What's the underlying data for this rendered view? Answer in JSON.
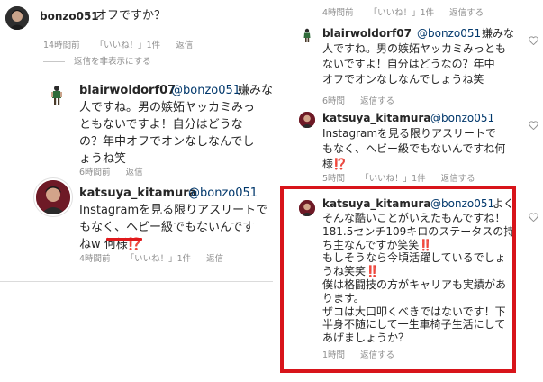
{
  "left_panel": {
    "top_comment": {
      "username": "bonzo051",
      "text": "オフですか？",
      "time": "14時間前",
      "likes": "「いいね！」1件",
      "reply": "返信",
      "toggle_replies": "返信を非表示にする"
    },
    "reply1": {
      "username": "blairwoldorf07",
      "mention": "@bonzo051",
      "text_first": "嫌みな",
      "text_rest": "人ですね。男の嫉妬ヤッカミみっ\nともないですよ！自分はどうな\nの？年中オフでオンなしなんでし\nょうね笑",
      "time": "6時間前",
      "reply": "返信"
    },
    "reply2": {
      "username": "katsuya_kitamura",
      "mention": "@bonzo051",
      "text": "Instagramを見る限りアスリートで\nもなく、ヘビー級でもないんです\nねw 何様⁉️",
      "time": "4時間前",
      "likes": "「いいね！」1件",
      "reply": "返信"
    }
  },
  "right_panel": {
    "top_meta": {
      "time": "4時間前",
      "likes": "「いいね！」1件",
      "reply": "返信する"
    },
    "comment1": {
      "username": "blairwoldorf07",
      "mention": "@bonzo051",
      "text_first": "嫌みな",
      "text_rest": "人ですね。男の嫉妬ヤッカミみっとも\nないですよ！自分はどうなの？年中\nオフでオンなしなんでしょうね笑",
      "time": "6時間",
      "reply": "返信する"
    },
    "comment2": {
      "username": "katsuya_kitamura",
      "mention": "@bonzo051",
      "text": "Instagramを見る限りアスリートで\nもなく、ヘビー級でもないんですね何\n様⁉️",
      "time": "5時間",
      "likes": "「いいね！」1件",
      "reply": "返信する"
    },
    "comment3": {
      "username": "katsuya_kitamura",
      "mention": "@bonzo051",
      "text_first": "よく",
      "text_rest": "そんな酷いことがいえたもんですね！\n181.5センチ109キロのステータスの持\nち主なんですか笑笑‼️\nもしそうなら今頃活躍しているでしょ\nうね笑笑‼️\n僕は格闘技の方がキャリアも実績があ\nります。\nザコは大口叩くべきではないです！下\n半身不随にして一生車椅子生活にして\nあげましょうか？",
      "time": "1時間",
      "reply": "返信する"
    }
  },
  "colors": {
    "text": "#262626",
    "muted": "#8e8e8e",
    "mention": "#00376b",
    "highlight": "#d8141a"
  }
}
